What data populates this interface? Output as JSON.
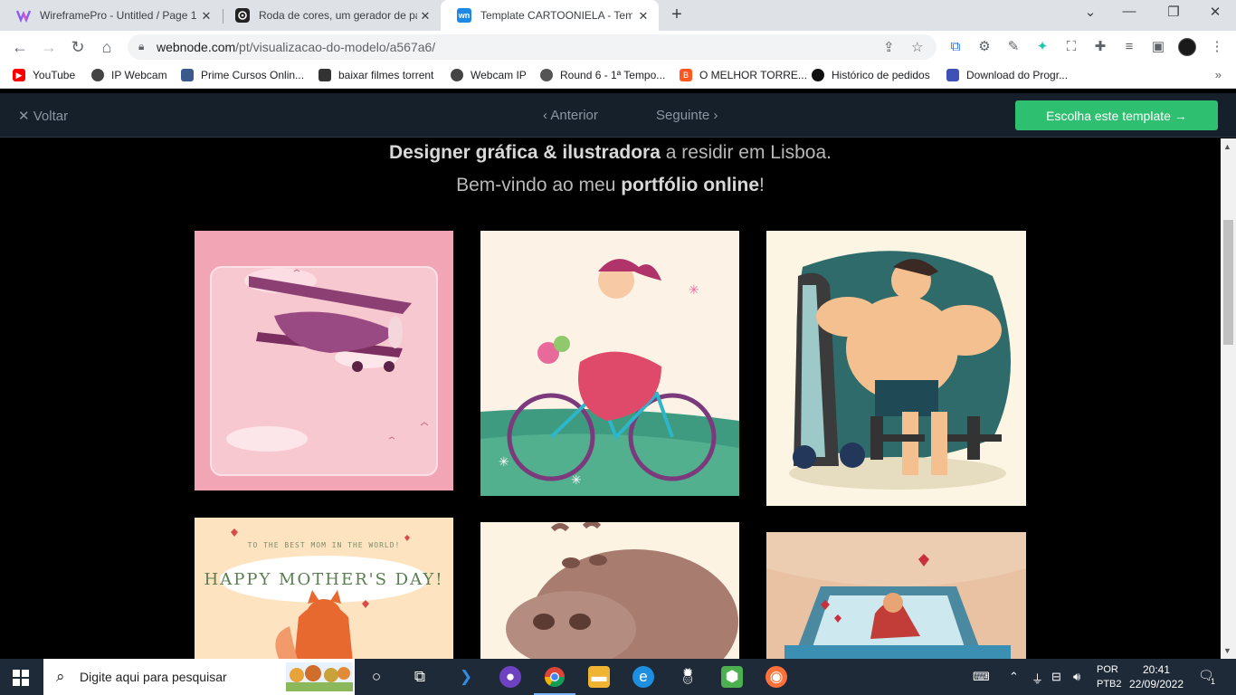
{
  "tabs": [
    {
      "title": "WireframePro - Untitled / Page 1",
      "icon": "wireframepro-icon",
      "color": "#8a5cf6"
    },
    {
      "title": "Roda de cores, um gerador de pa",
      "icon": "canva-color-icon",
      "color": "#222222"
    },
    {
      "title": "Template CARTOONIELA - Templ",
      "icon": "webnode-icon",
      "color": "#1e88e5",
      "icon_text": "wn"
    }
  ],
  "address": {
    "host": "webnode.com",
    "path": "/pt/visualizacao-do-modelo/a567a6/"
  },
  "bookmarks": [
    {
      "label": "YouTube",
      "icon": "youtube-icon",
      "color": "#ff0000"
    },
    {
      "label": "IP Webcam",
      "icon": "webcam-icon",
      "color": "#444444"
    },
    {
      "label": "Prime Cursos Onlin...",
      "icon": "prime-cursos-icon",
      "color": "#3a5a8c"
    },
    {
      "label": "baixar filmes torrent",
      "icon": "torrent-icon",
      "color": "#333333"
    },
    {
      "label": "Webcam IP",
      "icon": "webcam-ip-icon",
      "color": "#444444"
    },
    {
      "label": "Round 6 - 1ª Tempo...",
      "icon": "globe-icon",
      "color": "#555555"
    },
    {
      "label": "O MELHOR TORRE...",
      "icon": "blogger-icon",
      "color": "#ff5722"
    },
    {
      "label": "Histórico de pedidos",
      "icon": "orders-icon",
      "color": "#111111"
    },
    {
      "label": "Download do Progr...",
      "icon": "download-program-icon",
      "color": "#3f51b5"
    }
  ],
  "webnode": {
    "back": "Voltar",
    "prev": "Anterior",
    "next": "Seguinte",
    "choose": "Escolha este template",
    "accent": "#2fbf71"
  },
  "hero": {
    "line1_bold": "Designer gráfica & ilustradora",
    "line1_rest": " a residir em Lisboa.",
    "line2_start": "Bem-vindo ao meu ",
    "line2_bold": "portfólio online",
    "line2_end": "!"
  },
  "gallery": {
    "mothers_small": "TO THE BEST MOM IN THE WORLD!",
    "mothers_big": "HAPPY MOTHER'S DAY!"
  },
  "taskbar": {
    "search_placeholder": "Digite aqui para pesquisar",
    "lang_top": "POR",
    "lang_bottom": "PTB2",
    "time": "20:41",
    "date": "22/09/2022",
    "notifications": "1"
  }
}
